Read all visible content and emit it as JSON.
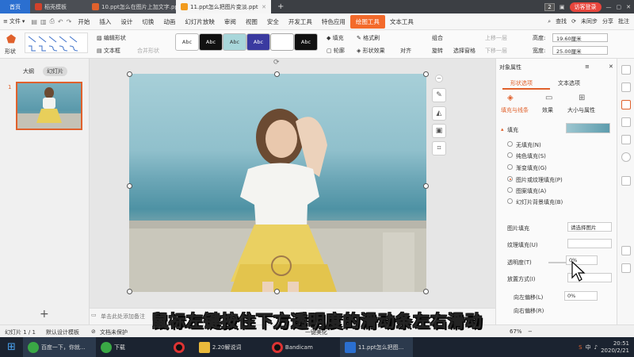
{
  "window_tabs": {
    "home": "首页",
    "template": "稻壳模板",
    "doc1": "10.ppt怎么在图片上加文字.ppt",
    "doc2": "11.ppt怎么把图片变淡.ppt",
    "counter": "2",
    "login": "访客登录"
  },
  "menubar": {
    "file": "文件",
    "items": [
      "开始",
      "插入",
      "设计",
      "切换",
      "动画",
      "幻灯片放映",
      "审阅",
      "视图",
      "安全",
      "开发工具",
      "特色应用",
      "绘图工具",
      "文本工具"
    ],
    "selected": "绘图工具",
    "search": "查找",
    "sync": "未同步",
    "share": "分享",
    "batch": "批注"
  },
  "ribbon": {
    "shape": "形状",
    "edit_shape": "编辑形状",
    "textbox": "文本框",
    "merge_shape": "合并形状",
    "style_label": "Abc",
    "fill": "填充",
    "format_brush": "格式刷",
    "outline": "轮廓",
    "shape_effect": "形状效果",
    "align": "对齐",
    "rotate": "旋转",
    "group": "组合",
    "select_pane": "选择窗格",
    "up_layer": "上移一层",
    "down_layer": "下移一层",
    "height_label": "高度:",
    "height_value": "19.60厘米",
    "width_label": "宽度:",
    "width_value": "25.00厘米"
  },
  "left_pane": {
    "outline_tab": "大纲",
    "slides_tab": "幻灯片",
    "slide_number": "1",
    "add": "+"
  },
  "notes": {
    "placeholder": "单击此处添加备注"
  },
  "right_panel": {
    "title": "对象属性",
    "tab_shape": "形状选项",
    "tab_text": "文本选项",
    "sub_fill": "填充与线条",
    "sub_effect": "效果",
    "sub_size": "大小与属性",
    "section_fill": "填充",
    "options": [
      "无填充(N)",
      "纯色填充(S)",
      "渐变填充(G)",
      "图片或纹理填充(P)",
      "图案填充(A)",
      "幻灯片背景填充(B)"
    ],
    "selected_option": "图片或纹理填充(P)",
    "picture_fill_label": "图片填充",
    "picture_fill_value": "请选择图片",
    "texture_fill_label": "纹理填充(U)",
    "transparency_label": "透明度(T)",
    "transparency_value": "0%",
    "placement_label": "放置方式(I)",
    "offset_left_label": "向左偏移(L)",
    "offset_left_value": "0%",
    "offset_right_label": "向右偏移(R)"
  },
  "statusbar": {
    "slide_info": "幻灯片 1 / 1",
    "design_template": "默认设计模板",
    "doc_unprotected": "文档未保护",
    "beautify": "一键美化",
    "zoom": "67%"
  },
  "taskbar": {
    "baidu": "百度一下，你就...",
    "download": "下载",
    "folder": "2.20解说词",
    "bandicam": "Bandicam",
    "ppt": "11.ppt怎么把图...",
    "time": "20:51",
    "date": "2020/2/21",
    "lang": "中"
  },
  "subtitle": "鼠标左键按住下方透明度的滑动条左右滑动",
  "colors": {
    "accent": "#e0612c",
    "tab_home": "#2b6fd0",
    "taskbar": "#1b2330",
    "selected_menu": "#f36a2b"
  }
}
